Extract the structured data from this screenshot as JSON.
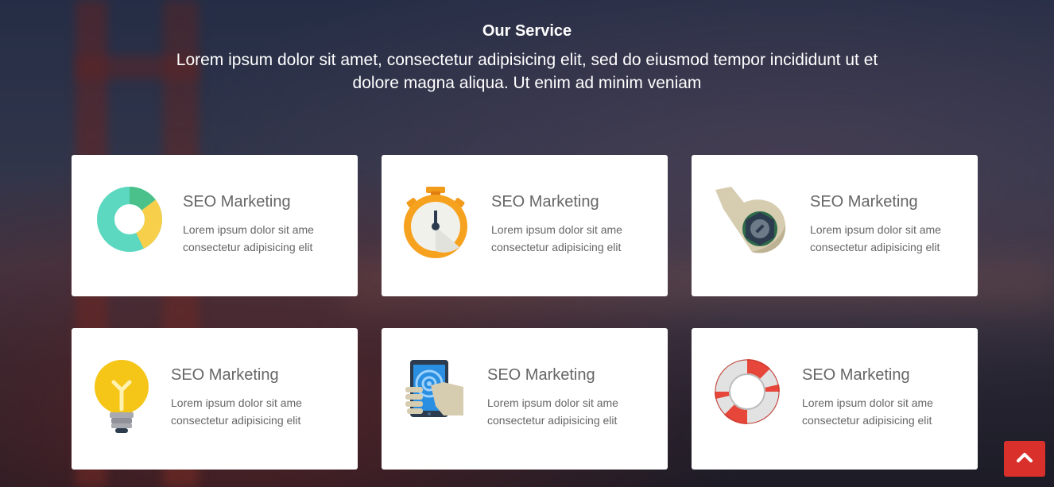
{
  "header": {
    "title": "Our Service",
    "subtitle": "Lorem ipsum dolor sit amet, consectetur adipisicing elit, sed do eiusmod tempor incididunt ut et dolore magna aliqua. Ut enim ad minim veniam"
  },
  "services": [
    {
      "title": "SEO Marketing",
      "desc_line1": "Lorem ipsum dolor sit ame",
      "desc_line2": "consectetur adipisicing elit",
      "icon": "donut-chart-icon"
    },
    {
      "title": "SEO Marketing",
      "desc_line1": "Lorem ipsum dolor sit ame",
      "desc_line2": "consectetur adipisicing elit",
      "icon": "stopwatch-icon"
    },
    {
      "title": "SEO Marketing",
      "desc_line1": "Lorem ipsum dolor sit ame",
      "desc_line2": "consectetur adipisicing elit",
      "icon": "wrench-icon"
    },
    {
      "title": "SEO Marketing",
      "desc_line1": "Lorem ipsum dolor sit ame",
      "desc_line2": "consectetur adipisicing elit",
      "icon": "lightbulb-icon"
    },
    {
      "title": "SEO Marketing",
      "desc_line1": "Lorem ipsum dolor sit ame",
      "desc_line2": "consectetur adipisicing elit",
      "icon": "mobile-touch-icon"
    },
    {
      "title": "SEO Marketing",
      "desc_line1": "Lorem ipsum dolor sit ame",
      "desc_line2": "consectetur adipisicing elit",
      "icon": "lifebuoy-icon"
    }
  ],
  "scroll_top": {
    "icon": "chevron-up-icon",
    "color": "#d9302c"
  }
}
